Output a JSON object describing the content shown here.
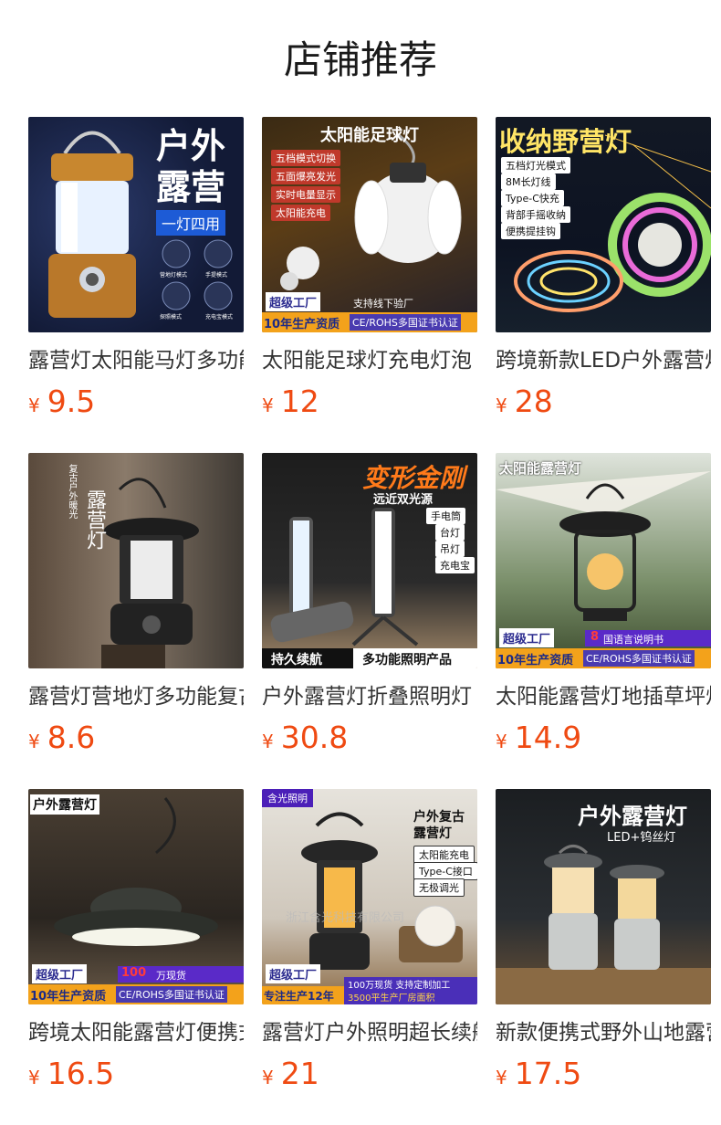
{
  "page_title": "店铺推荐",
  "currency": "¥",
  "products": [
    {
      "name": "露营灯太阳能马灯多功能",
      "price": "9.5",
      "image_text": {
        "headline_1": "户外",
        "headline_2": "露营",
        "banner": "一灯四用",
        "modes": [
          "营地灯模式",
          "手提模式",
          "探照模式",
          "充电宝模式"
        ]
      }
    },
    {
      "name": "太阳能足球灯充电灯泡",
      "price": "12",
      "image_text": {
        "headline": "太阳能足球灯",
        "features": [
          "五档模式切换",
          "五面爆亮发光",
          "实时电量显示",
          "太阳能充电"
        ],
        "badge": "超级工厂",
        "badge_note": "支持线下验厂",
        "years": "10年生产资质",
        "cert": "CE/ROHS多国证书认证"
      }
    },
    {
      "name": "跨境新款LED户外露营灯",
      "price": "28",
      "image_text": {
        "headline": "收纳野营灯",
        "features": [
          "五档灯光模式",
          "8M长灯线",
          "Type-C快充",
          "背部手摇收纳",
          "便携提挂钩"
        ]
      }
    },
    {
      "name": "露营灯营地灯多功能复古",
      "price": "8.6",
      "image_text": {
        "small": "复古户外暖光",
        "headline": "露营灯"
      }
    },
    {
      "name": "户外露营灯折叠照明灯",
      "price": "30.8",
      "image_text": {
        "headline": "变形金刚",
        "subhead": "远近双光源",
        "features": [
          "手电筒",
          "台灯",
          "吊灯",
          "充电宝"
        ],
        "footer_left": "持久续航",
        "footer_right": "多功能照明产品"
      }
    },
    {
      "name": "太阳能露营灯地插草坪灯",
      "price": "14.9",
      "image_text": {
        "headline": "太阳能露营灯",
        "badge": "超级工厂",
        "lang_num": "8",
        "lang": "国语言说明书",
        "years": "10年生产资质",
        "cert": "CE/ROHS多国证书认证"
      }
    },
    {
      "name": "跨境太阳能露营灯便携式",
      "price": "16.5",
      "image_text": {
        "headline": "户外露营灯",
        "badge": "超级工厂",
        "cash_num": "100",
        "cash": "万现货",
        "years": "10年生产资质",
        "cert": "CE/ROHS多国证书认证"
      }
    },
    {
      "name": "露营灯户外照明超长续航",
      "price": "21",
      "image_text": {
        "corner": "含光照明",
        "headline_1": "户外复古",
        "headline_2": "露营灯",
        "features": [
          "太阳能充电",
          "Type-C接口",
          "无极调光"
        ],
        "watermark": "浙江含光科技有限公司",
        "badge": "超级工厂",
        "focus": "专注生产12年",
        "stock": "100万现货 支持定制加工",
        "area": "3500平生产厂房面积"
      }
    },
    {
      "name": "新款便携式野外山地露营",
      "price": "17.5",
      "image_text": {
        "headline": "户外露营灯",
        "subhead": "LED+钨丝灯"
      }
    }
  ],
  "colors": {
    "price": "#ef4a12",
    "title": "#1a1a1a",
    "name": "#333333"
  }
}
